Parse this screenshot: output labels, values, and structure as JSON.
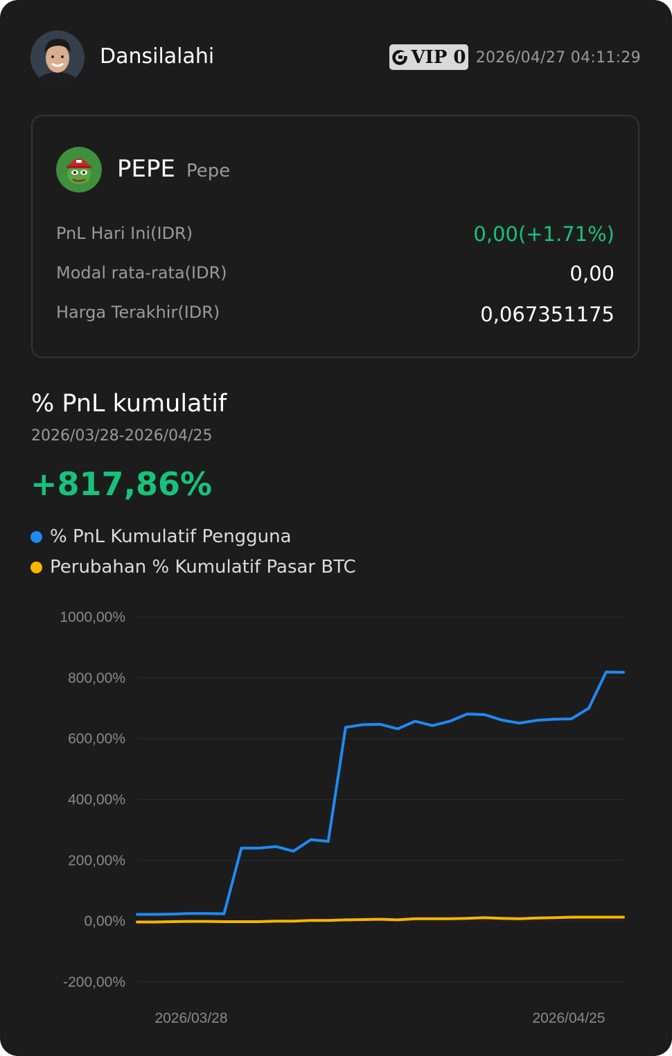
{
  "header": {
    "username": "Dansilalahi",
    "vip_label": "VIP 0",
    "timestamp": "2026/04/27 04:11:29"
  },
  "coin": {
    "symbol": "PEPE",
    "name": "Pepe",
    "rows": [
      {
        "label": "PnL Hari Ini(IDR)",
        "value": "0,00(+1.71%)"
      },
      {
        "label": "Modal rata-rata(IDR)",
        "value": "0,00"
      },
      {
        "label": "Harga Terakhir(IDR)",
        "value": "0,067351175"
      }
    ]
  },
  "pnl": {
    "title": "% PnL kumulatif",
    "date_range": "2026/03/28-2026/04/25",
    "total": "+817,86%"
  },
  "legend": [
    {
      "label": "% PnL Kumulatif Pengguna",
      "color": "#1f8af3"
    },
    {
      "label": "Perubahan % Kumulatif Pasar BTC",
      "color": "#f7b500"
    }
  ],
  "chart_data": {
    "type": "line",
    "y_tick_labels": [
      "1000,00%",
      "800,00%",
      "600,00%",
      "400,00%",
      "200,00%",
      "0,00%",
      "-200,00%"
    ],
    "y_ticks": [
      1000,
      800,
      600,
      400,
      200,
      0,
      -200
    ],
    "ylim": [
      -200,
      1000
    ],
    "x_tick_labels": [
      "2026/03/28",
      "2026/04/25"
    ],
    "x_count": 29,
    "grid": true,
    "series": [
      {
        "name": "% PnL Kumulatif Pengguna",
        "color": "#1f8af3",
        "values": [
          22,
          22,
          23,
          25,
          25,
          24,
          240,
          240,
          245,
          230,
          268,
          262,
          637,
          646,
          647,
          632,
          657,
          643,
          657,
          681,
          679,
          661,
          651,
          660,
          664,
          665,
          700,
          819,
          818
        ]
      },
      {
        "name": "Perubahan % Kumulatif Pasar BTC",
        "color": "#f7b500",
        "values": [
          -3,
          -3,
          -2,
          -1,
          -1,
          -2,
          -2,
          -2,
          0,
          0,
          2,
          2,
          4,
          5,
          6,
          4,
          8,
          8,
          8,
          9,
          11,
          9,
          8,
          10,
          11,
          13,
          13,
          13,
          13
        ]
      }
    ]
  }
}
